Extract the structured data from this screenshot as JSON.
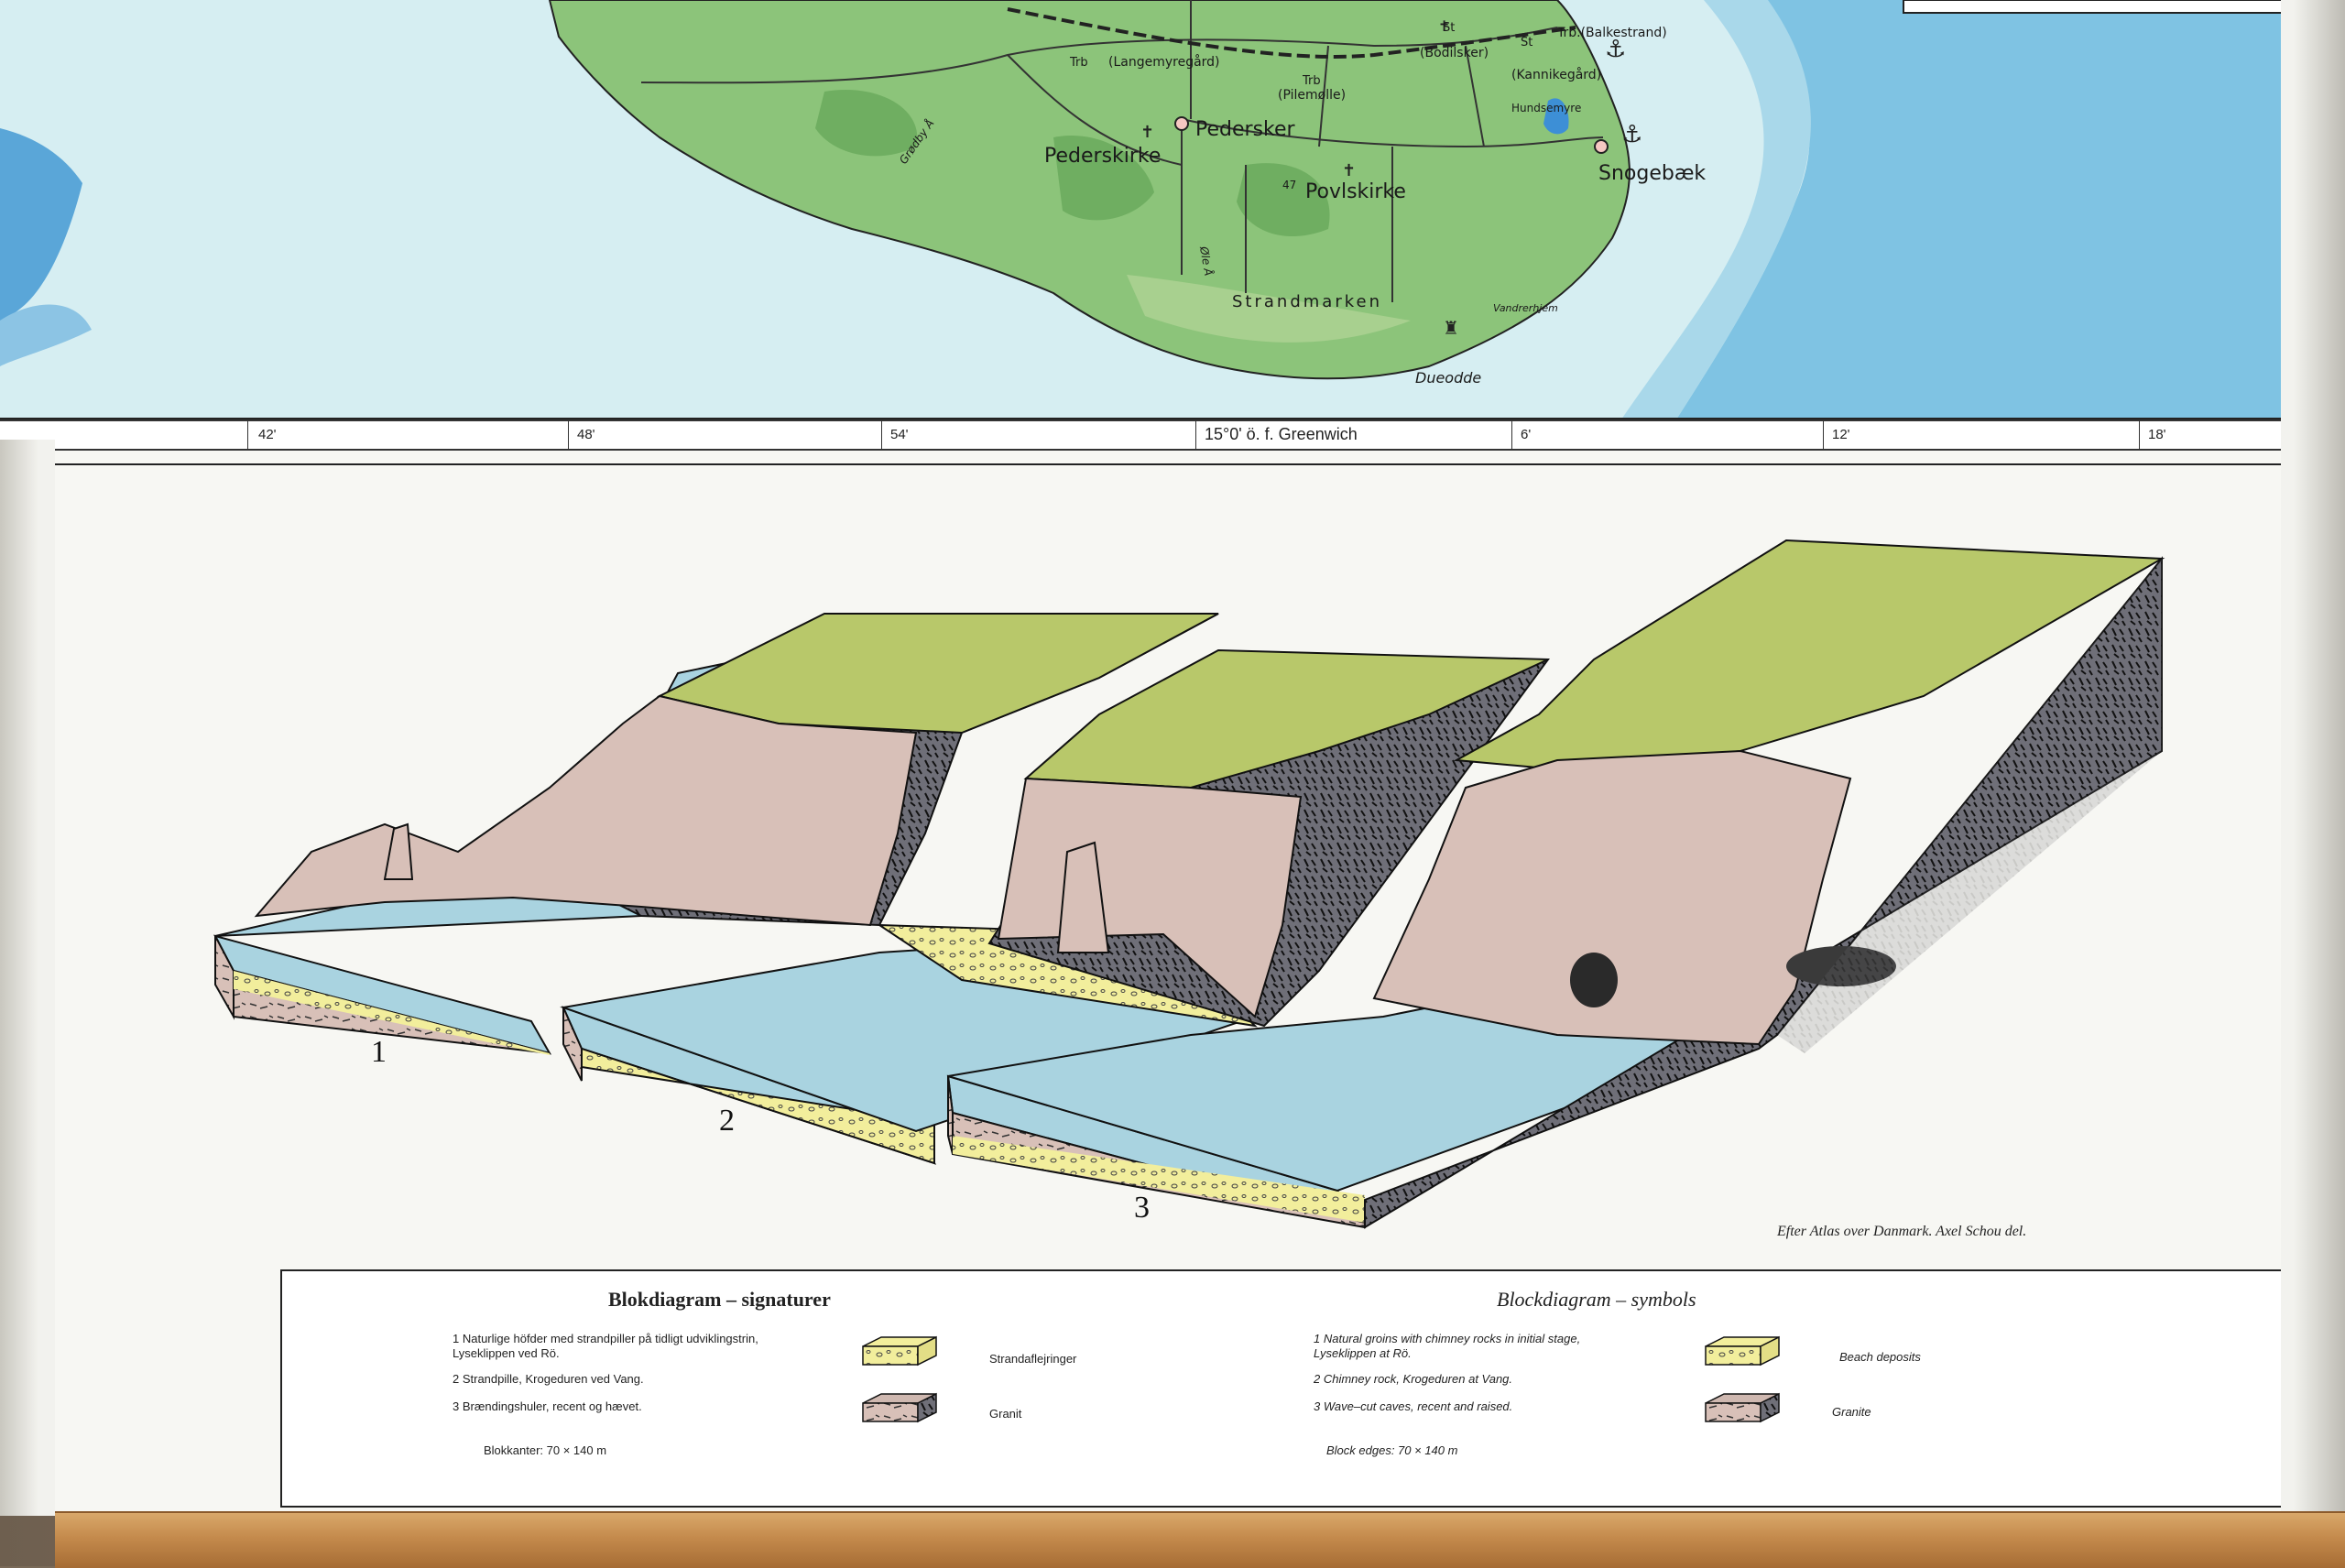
{
  "map": {
    "places": [
      {
        "id": "pedersker",
        "name": "Pedersker"
      },
      {
        "id": "pederskirke",
        "name": "Pederskirke"
      },
      {
        "id": "povlskirke",
        "name": "Povlskirke"
      },
      {
        "id": "snogebaek",
        "name": "Snogebæk"
      },
      {
        "id": "strandmarken",
        "name": "Strandmarken"
      },
      {
        "id": "dueodde",
        "name": "Dueodde"
      },
      {
        "id": "langemyregaard",
        "name": "(Langemyregård)"
      },
      {
        "id": "pilemolle",
        "name": "(Pilemølle)"
      },
      {
        "id": "bodilsker",
        "name": "(Bodilsker)"
      },
      {
        "id": "kannikegaard",
        "name": "(Kannikegård)"
      },
      {
        "id": "balkestrand",
        "name": "Trb.(Balkestrand)"
      },
      {
        "id": "hundsemyre",
        "name": "Hundsemyre"
      },
      {
        "id": "vandrerhjem",
        "name": "Vandrerhjem"
      },
      {
        "id": "trb1",
        "name": "Trb"
      },
      {
        "id": "trb2",
        "name": "Trb"
      },
      {
        "id": "st1",
        "name": "St"
      },
      {
        "id": "st2",
        "name": "St"
      },
      {
        "id": "spot47",
        "name": "47"
      },
      {
        "id": "grodby",
        "name": "Grødby Å"
      },
      {
        "id": "olea",
        "name": "Øle Å"
      }
    ],
    "scale_ticks": [
      "42'",
      "48'",
      "54'",
      "15°0' ö. f. Greenwich",
      "6'",
      "12'",
      "18'"
    ],
    "colors": {
      "sea_shallow": "#cde9ee",
      "sea_deep": "#7fc3e3",
      "land": "#8cc47a",
      "land_dark": "#6fae61",
      "lake": "#3d8fd6"
    }
  },
  "diagram": {
    "credit": "Efter Atlas over Danmark. Axel Schou del.",
    "blocks": [
      {
        "number": "1"
      },
      {
        "number": "2"
      },
      {
        "number": "3"
      }
    ],
    "colors": {
      "grass": "#b8c86a",
      "cliff": "#d8c0b8",
      "water": "#a9d3e0",
      "sand": "#f2ee9c",
      "granite": "#6f6f78"
    }
  },
  "legend": {
    "da": {
      "title": "Blokdiagram – signaturer",
      "items": [
        "1  Naturlige höfder med strandpiller på tidligt udviklingstrin, Lyseklippen ved Rö.",
        "2  Strandpille, Krogeduren ved Vang.",
        "3  Brændingshuler, recent og hævet."
      ],
      "block_edges": "Blokkanter:  70 × 140 m",
      "swatches": [
        "Strandaflejringer",
        "Granit"
      ]
    },
    "en": {
      "title": "Blockdiagram – symbols",
      "items": [
        "1  Natural groins with chimney rocks in initial stage, Lyseklippen at Rö.",
        "2  Chimney rock, Krogeduren at Vang.",
        "3  Wave–cut caves,  recent and raised."
      ],
      "block_edges": "Block edges:  70 × 140 m",
      "swatches": [
        "Beach deposits",
        "Granite"
      ]
    }
  }
}
